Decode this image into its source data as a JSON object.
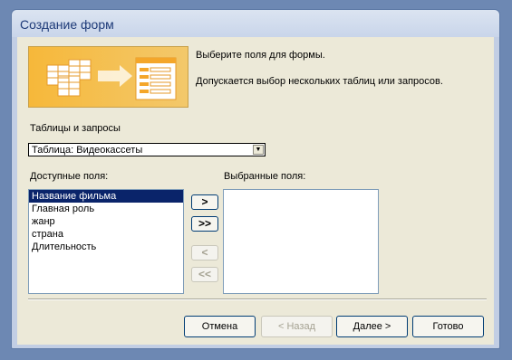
{
  "window": {
    "title": "Создание форм"
  },
  "banner": {
    "icon": "form-wizard-illustration"
  },
  "intro": {
    "line1": "Выберите поля для формы.",
    "line2": "Допускается выбор нескольких таблиц или запросов."
  },
  "tables_queries": {
    "label": "Таблицы и запросы",
    "selected": "Таблица: Видеокассеты"
  },
  "available_fields": {
    "label": "Доступные поля:",
    "items": [
      "Название фильма",
      "Главная роль",
      "жанр",
      "страна",
      "Длительность"
    ],
    "selected_item": "Название фильма"
  },
  "selected_fields": {
    "label": "Выбранные поля:",
    "items": []
  },
  "move_buttons": {
    "add_one": ">",
    "add_all": ">>",
    "remove_one": "<",
    "remove_all": "<<"
  },
  "footer": {
    "cancel": "Отмена",
    "back": "< Назад",
    "next": "Далее >",
    "finish": "Готово"
  },
  "colors": {
    "title_bar": "#dbe4f1",
    "client_bg": "#ece9d8",
    "selection": "#0a246a",
    "banner_orange": "#f6b83a"
  }
}
